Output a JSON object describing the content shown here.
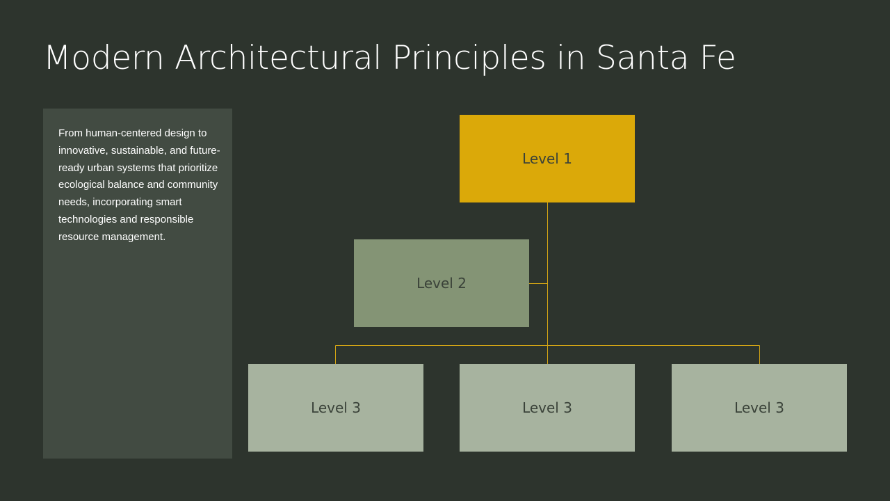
{
  "slide": {
    "title": "Modern Architectural Principles in Santa Fe",
    "description": "From human-centered design to innovative, sustainable, and future-ready urban systems that prioritize ecological balance and community needs, incorporating smart technologies and responsible resource management."
  },
  "org_chart": {
    "root": {
      "label": "Level 1",
      "color": "#dba909"
    },
    "assistant": {
      "label": "Level 2",
      "color": "#849475"
    },
    "children": [
      {
        "label": "Level 3",
        "color": "#a7b39f"
      },
      {
        "label": "Level 3",
        "color": "#a7b39f"
      },
      {
        "label": "Level 3",
        "color": "#a7b39f"
      }
    ],
    "connector_color": "#d4a514"
  }
}
